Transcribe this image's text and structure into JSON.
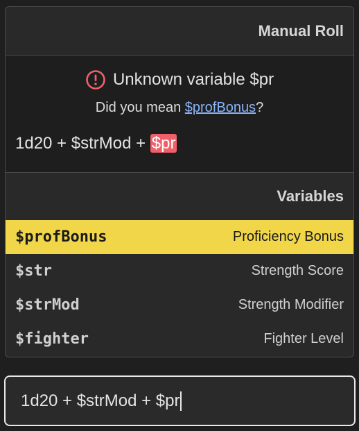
{
  "panel": {
    "title": "Manual Roll",
    "error": {
      "message": "Unknown variable $pr",
      "suggest_prefix": "Did you mean ",
      "suggest_link": "$profBonus",
      "suggest_suffix": "?",
      "expr_prefix": "1d20 + $strMod + ",
      "expr_bad": "$pr"
    },
    "variables_title": "Variables",
    "variables": [
      {
        "name": "$profBonus",
        "desc": "Proficiency Bonus",
        "selected": true
      },
      {
        "name": "$str",
        "desc": "Strength Score",
        "selected": false
      },
      {
        "name": "$strMod",
        "desc": "Strength Modifier",
        "selected": false
      },
      {
        "name": "$fighter",
        "desc": "Fighter Level",
        "selected": false
      }
    ]
  },
  "input": {
    "value": "1d20 + $strMod + $pr"
  },
  "colors": {
    "highlight": "#f2d649",
    "error": "#f0606a",
    "link": "#8ab4f8"
  }
}
